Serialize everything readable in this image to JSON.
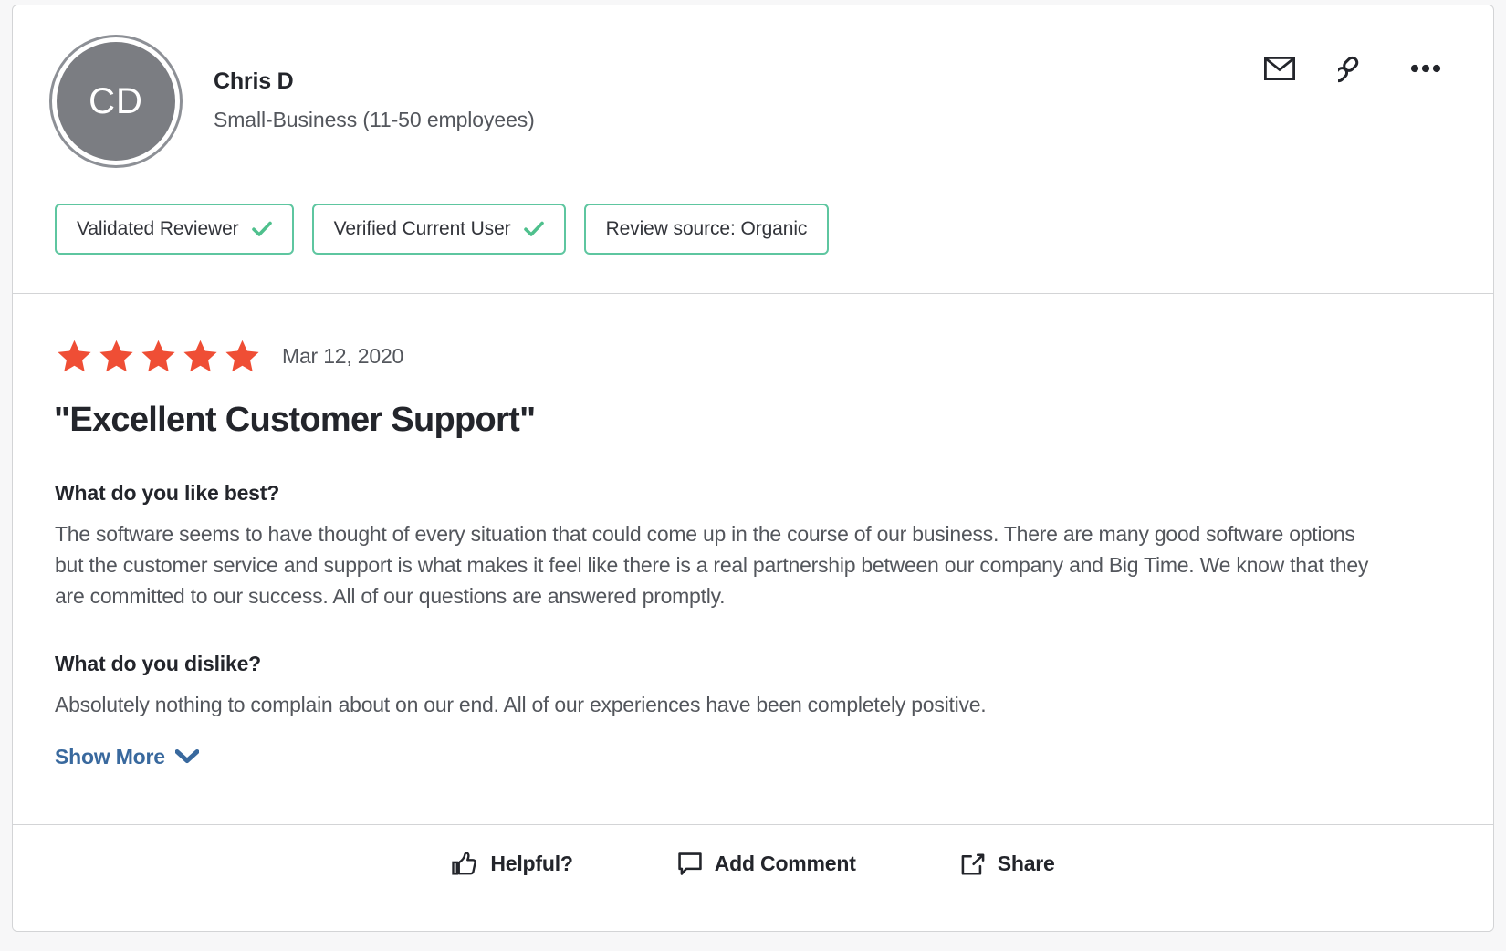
{
  "card": {
    "reviewer": {
      "initials": "CD",
      "name": "Chris D",
      "segment": "Small-Business (11-50 employees)"
    },
    "header_actions": [
      {
        "name": "email-icon",
        "tooltip": "Email"
      },
      {
        "name": "link-icon",
        "tooltip": "Copy link"
      },
      {
        "name": "more-options-icon",
        "tooltip": "More options"
      }
    ],
    "badges": [
      {
        "label": "Validated Reviewer",
        "has_check": true
      },
      {
        "label": "Verified Current User",
        "has_check": true
      },
      {
        "label": "Review source: Organic",
        "has_check": false
      }
    ],
    "review": {
      "rating": 5,
      "max_rating": 5,
      "date": "Mar 12, 2020",
      "title": "\"Excellent Customer Support\"",
      "sections": [
        {
          "question": "What do you like best?",
          "answer": "The software seems to have thought of every situation that could come up in the course of our business. There are many good software options but the customer service and support is what makes it feel like there is a real partnership between our company and Big Time. We know that they are committed to our success. All of our questions are answered promptly."
        },
        {
          "question": "What do you dislike?",
          "answer": "Absolutely nothing to complain about on our end. All of our experiences have been completely positive."
        }
      ],
      "show_more_label": "Show More"
    },
    "footer_actions": [
      {
        "label": "Helpful?",
        "icon": "thumbs-up-icon"
      },
      {
        "label": "Add Comment",
        "icon": "comment-icon"
      },
      {
        "label": "Share",
        "icon": "share-icon"
      }
    ]
  },
  "colors": {
    "star": "#EF4E35",
    "badge_border": "#5EC6A0",
    "check": "#4FC08D",
    "link": "#39699E",
    "avatar": "#7B7D82",
    "text_primary": "#23252B",
    "text_secondary": "#53565C",
    "card_border": "#D3D4D6"
  }
}
